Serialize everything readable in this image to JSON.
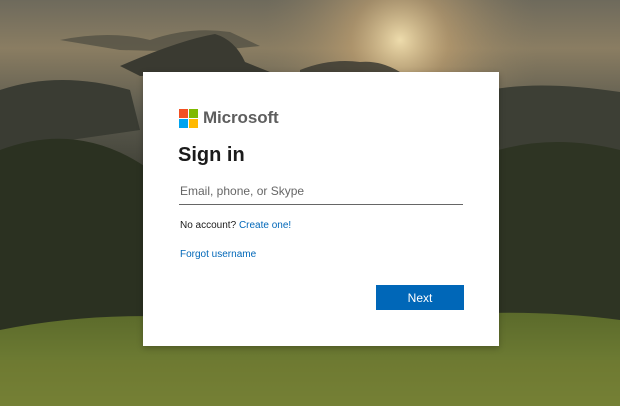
{
  "brand": {
    "name": "Microsoft",
    "logo_colors": [
      "#f25022",
      "#7fba00",
      "#00a4ef",
      "#ffb900"
    ]
  },
  "signin": {
    "title": "Sign in",
    "email_placeholder": "Email, phone, or Skype",
    "email_value": "",
    "no_account_text": "No account?",
    "create_link": "Create one!",
    "forgot_link": "Forgot username",
    "next_label": "Next"
  },
  "colors": {
    "accent": "#0067b8",
    "card_bg": "#ffffff"
  }
}
